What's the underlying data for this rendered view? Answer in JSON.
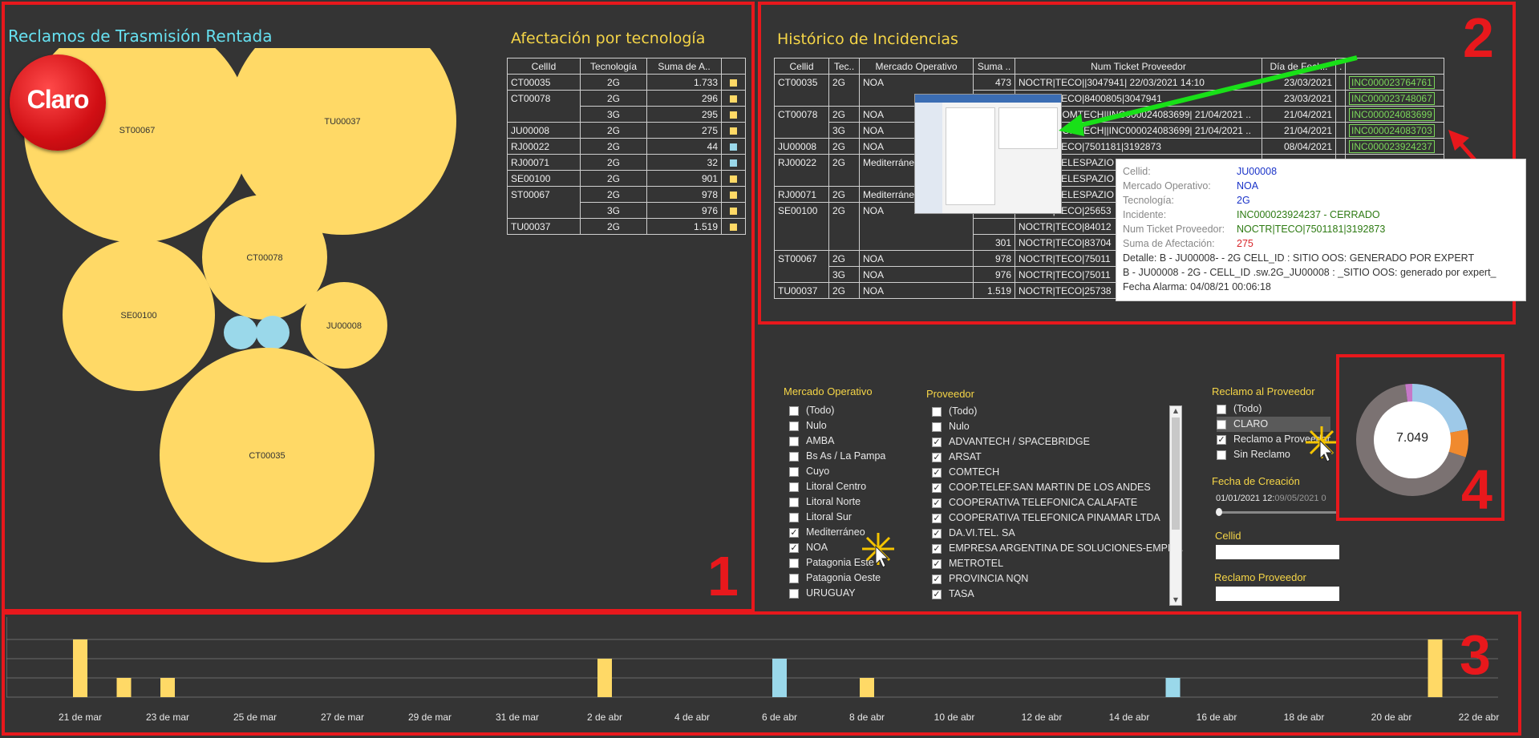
{
  "colors": {
    "yellow": "#ffd966",
    "cyan": "#9ad8ea",
    "red": "#e8181c",
    "green": "#7bd85a"
  },
  "logo": {
    "text": "Claro"
  },
  "panel1": {
    "title": "Reclamos de Trasmisión Rentada",
    "bubbles": [
      {
        "label": "ST00067",
        "color": "yellow"
      },
      {
        "label": "TU00037",
        "color": "yellow"
      },
      {
        "label": "CT00078",
        "color": "yellow"
      },
      {
        "label": "SE00100",
        "color": "yellow"
      },
      {
        "label": "",
        "color": "cyan"
      },
      {
        "label": "",
        "color": "cyan"
      },
      {
        "label": "JU00008",
        "color": "yellow"
      },
      {
        "label": "CT00035",
        "color": "yellow"
      }
    ],
    "number": "1"
  },
  "tech_table": {
    "title": "Afectación por tecnología",
    "headers": [
      "CellId",
      "Tecnología",
      "Suma de A..",
      ""
    ],
    "rows": [
      {
        "cell": "CT00035",
        "tech": "2G",
        "sum": "1.733",
        "color": "yellow"
      },
      {
        "cell": "CT00078",
        "tech": "2G",
        "sum": "296",
        "color": "yellow"
      },
      {
        "cell": "",
        "tech": "3G",
        "sum": "295",
        "color": "yellow"
      },
      {
        "cell": "JU00008",
        "tech": "2G",
        "sum": "275",
        "color": "yellow"
      },
      {
        "cell": "RJ00022",
        "tech": "2G",
        "sum": "44",
        "color": "cyan"
      },
      {
        "cell": "RJ00071",
        "tech": "2G",
        "sum": "32",
        "color": "cyan"
      },
      {
        "cell": "SE00100",
        "tech": "2G",
        "sum": "901",
        "color": "yellow"
      },
      {
        "cell": "ST00067",
        "tech": "2G",
        "sum": "978",
        "color": "yellow"
      },
      {
        "cell": "",
        "tech": "3G",
        "sum": "976",
        "color": "yellow"
      },
      {
        "cell": "TU00037",
        "tech": "2G",
        "sum": "1.519",
        "color": "yellow"
      }
    ]
  },
  "history": {
    "title": "Histórico de Incidencias",
    "number": "2",
    "headers": [
      "Cellid",
      "Tec..",
      "Mercado Operativo",
      "Suma ..",
      "Num Ticket Proveedor",
      "Día de Fech..",
      ".",
      ""
    ],
    "rows": [
      {
        "cell": "CT00035",
        "tech": "2G",
        "market": "NOA",
        "sum": "473",
        "ticket": "NOCTR|TECO||3047941| 22/03/2021 14:10",
        "date": "23/03/2021",
        "inc": "INC000023764761"
      },
      {
        "cell": "",
        "tech": "",
        "market": "",
        "sum": "",
        "ticket": "NOCTR|TECO|8400805|3047941",
        "date": "23/03/2021",
        "inc": "INC000023748067"
      },
      {
        "cell": "CT00078",
        "tech": "2G",
        "market": "NOA",
        "sum": "",
        "ticket": "NOCTR|COMTECH||INC000024083699| 21/04/2021 ..",
        "date": "21/04/2021",
        "inc": "INC000024083699"
      },
      {
        "cell": "",
        "tech": "3G",
        "market": "NOA",
        "sum": "",
        "ticket": "NOCTR|COMTECH||INC000024083699| 21/04/2021 ..",
        "date": "21/04/2021",
        "inc": "INC000024083703"
      },
      {
        "cell": "JU00008",
        "tech": "2G",
        "market": "NOA",
        "sum": "",
        "ticket": "NOCTR|TECO|7501181|3192873",
        "date": "08/04/2021",
        "inc": "INC000023924237"
      },
      {
        "cell": "RJ00022",
        "tech": "2G",
        "market": "Mediterráneo",
        "sum": "",
        "ticket": "NOCTR|TELESPAZIO",
        "date": "",
        "inc": ""
      },
      {
        "cell": "",
        "tech": "",
        "market": "",
        "sum": "",
        "ticket": "NOCTR|TELESPAZIO",
        "date": "",
        "inc": ""
      },
      {
        "cell": "RJ00071",
        "tech": "2G",
        "market": "Mediterráneo",
        "sum": "",
        "ticket": "NOCTR|TELESPAZIO",
        "date": "",
        "inc": ""
      },
      {
        "cell": "SE00100",
        "tech": "2G",
        "market": "NOA",
        "sum": "",
        "ticket": "NOCTR|TECO|25653",
        "date": "",
        "inc": ""
      },
      {
        "cell": "",
        "tech": "",
        "market": "",
        "sum": "",
        "ticket": "NOCTR|TECO|84012",
        "date": "",
        "inc": ""
      },
      {
        "cell": "",
        "tech": "",
        "market": "",
        "sum": "301",
        "ticket": "NOCTR|TECO|83704",
        "date": "",
        "inc": ""
      },
      {
        "cell": "ST00067",
        "tech": "2G",
        "market": "NOA",
        "sum": "978",
        "ticket": "NOCTR|TECO|75011",
        "date": "",
        "inc": ""
      },
      {
        "cell": "",
        "tech": "3G",
        "market": "NOA",
        "sum": "976",
        "ticket": "NOCTR|TECO|75011",
        "date": "",
        "inc": ""
      },
      {
        "cell": "TU00037",
        "tech": "2G",
        "market": "NOA",
        "sum": "1.519",
        "ticket": "NOCTR|TECO|25738",
        "date": "",
        "inc": ""
      }
    ]
  },
  "tooltip": {
    "rows": [
      {
        "key": "Cellid:",
        "value": "JU00008",
        "color": "#1a33c8"
      },
      {
        "key": "Mercado Operativo:",
        "value": "NOA",
        "color": "#1a33c8"
      },
      {
        "key": "Tecnología:",
        "value": "2G",
        "color": "#1a33c8"
      },
      {
        "key": "Incidente:",
        "value": "INC000023924237 - CERRADO",
        "color": "#2d7a12"
      },
      {
        "key": "Num Ticket Proveedor:",
        "value": "NOCTR|TECO|7501181|3192873",
        "color": "#2d7a12"
      },
      {
        "key": "Suma de Afectación:",
        "value": "275",
        "color": "#d8262a"
      }
    ],
    "lines": [
      "Detalle: B - JU00008- - 2G CELL_ID : SITIO OOS: GENERADO POR EXPERT",
      "B - JU00008 - 2G - CELL_ID .sw.2G_JU00008 : _SITIO OOS: generado por expert_",
      "Fecha Alarma: 04/08/21 00:06:18"
    ]
  },
  "filters": {
    "mercado": {
      "label": "Mercado Operativo",
      "items": [
        {
          "label": "(Todo)",
          "checked": false
        },
        {
          "label": "Nulo",
          "checked": false
        },
        {
          "label": "AMBA",
          "checked": false
        },
        {
          "label": "Bs As / La Pampa",
          "checked": false
        },
        {
          "label": "Cuyo",
          "checked": false
        },
        {
          "label": "Litoral Centro",
          "checked": false
        },
        {
          "label": "Litoral Norte",
          "checked": false
        },
        {
          "label": "Litoral Sur",
          "checked": false
        },
        {
          "label": "Mediterráneo",
          "checked": true
        },
        {
          "label": "NOA",
          "checked": true
        },
        {
          "label": "Patagonia Este",
          "checked": false
        },
        {
          "label": "Patagonia Oeste",
          "checked": false
        },
        {
          "label": "URUGUAY",
          "checked": false
        }
      ]
    },
    "proveedor": {
      "label": "Proveedor",
      "items": [
        {
          "label": "(Todo)",
          "checked": false
        },
        {
          "label": "Nulo",
          "checked": false
        },
        {
          "label": "ADVANTECH / SPACEBRIDGE",
          "checked": true
        },
        {
          "label": "ARSAT",
          "checked": true
        },
        {
          "label": "COMTECH",
          "checked": true
        },
        {
          "label": "COOP.TELEF.SAN MARTIN DE LOS ANDES",
          "checked": true
        },
        {
          "label": "COOPERATIVA TELEFONICA CALAFATE",
          "checked": true
        },
        {
          "label": "COOPERATIVA TELEFONICA PINAMAR LTDA",
          "checked": true
        },
        {
          "label": "DA.VI.TEL. SA",
          "checked": true
        },
        {
          "label": "EMPRESA ARGENTINA DE SOLUCIONES-EMPR...",
          "checked": true
        },
        {
          "label": "METROTEL",
          "checked": true
        },
        {
          "label": "PROVINCIA NQN",
          "checked": true
        },
        {
          "label": "TASA",
          "checked": true
        }
      ]
    },
    "reclamo": {
      "label": "Reclamo al Proveedor",
      "items": [
        {
          "label": "(Todo)",
          "checked": false
        },
        {
          "label": "CLARO",
          "checked": false
        },
        {
          "label": "Reclamo a Proveedor",
          "checked": true
        },
        {
          "label": "Sin Reclamo",
          "checked": false
        }
      ]
    },
    "fecha": {
      "label": "Fecha de Creación",
      "from": "01/01/2021 12:",
      "to": "09/05/2021 0"
    },
    "cellid": {
      "label": "Cellid",
      "value": ""
    },
    "reclamo_prov": {
      "label": "Reclamo Proveedor",
      "value": ""
    }
  },
  "donut": {
    "center_label": "7.049",
    "number": "4",
    "segments": [
      {
        "name": "",
        "value": 22,
        "color": "#9ec9e8"
      },
      {
        "name": "",
        "value": 8,
        "color": "#f08a2e"
      },
      {
        "name": "",
        "value": 68,
        "color": "#7b7272"
      },
      {
        "name": "",
        "value": 2,
        "color": "#c678c8"
      }
    ]
  },
  "timeline": {
    "number": "3",
    "x_labels": [
      "21 de mar",
      "23 de mar",
      "25 de mar",
      "27 de mar",
      "29 de mar",
      "31 de mar",
      "2 de abr",
      "4 de abr",
      "6 de abr",
      "8 de abr",
      "10 de abr",
      "12 de abr",
      "14 de abr",
      "16 de abr",
      "18 de abr",
      "20 de abr",
      "22 de abr"
    ]
  },
  "chart_data": {
    "type": "bar",
    "x": [
      "2021-03-21",
      "2021-03-22",
      "2021-03-23",
      "2021-04-02",
      "2021-04-06",
      "2021-04-08",
      "2021-04-15",
      "2021-04-21"
    ],
    "values": [
      3,
      1,
      1,
      2,
      2,
      1,
      1,
      3
    ],
    "colors": [
      "yellow",
      "yellow",
      "yellow",
      "yellow",
      "cyan",
      "yellow",
      "cyan",
      "yellow"
    ],
    "xlabel": "",
    "ylabel": "",
    "ylim": [
      0,
      3
    ],
    "grid": true
  }
}
